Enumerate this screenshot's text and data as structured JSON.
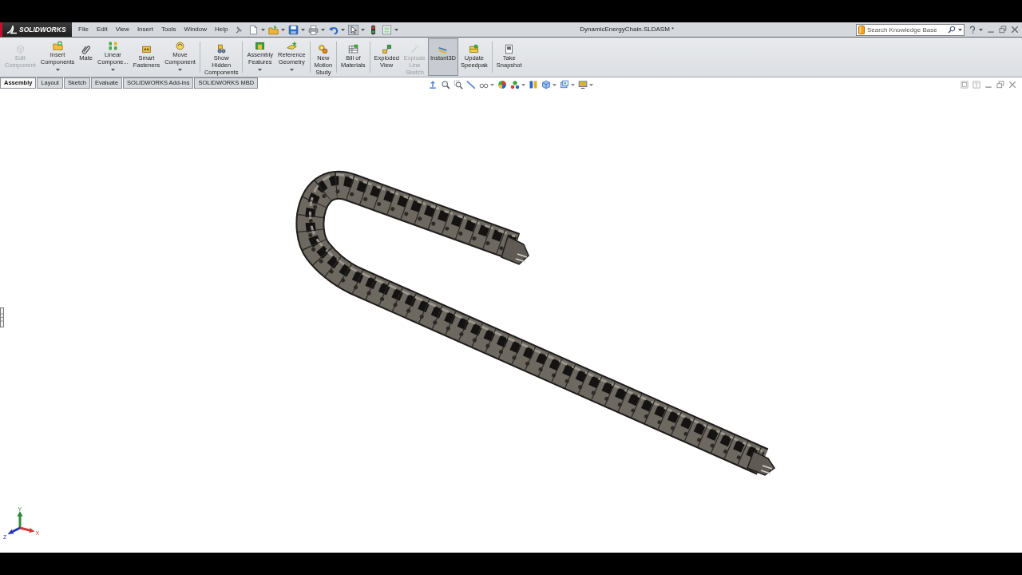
{
  "title_bar": {
    "brand": "SOLIDWORKS",
    "menu": [
      "File",
      "Edit",
      "View",
      "Insert",
      "Tools",
      "Window",
      "Help"
    ],
    "quick_access": [
      {
        "has_menu": true,
        "selected": false
      },
      {
        "has_menu": true,
        "selected": false
      },
      {
        "has_menu": true,
        "selected": false
      },
      {
        "has_menu": true,
        "selected": false
      },
      {
        "has_menu": true,
        "selected": false
      },
      {
        "has_menu": true,
        "selected": true
      },
      {
        "has_menu": false,
        "selected": false
      },
      {
        "has_menu": true,
        "selected": false
      }
    ],
    "document_title": "DynamicEnergyChain.SLDASM *",
    "search": {
      "placeholder": "Search Knowledge Base"
    }
  },
  "command_manager": {
    "groups": [
      [
        {
          "lines": [
            "Edit",
            "Component"
          ],
          "has_menu": false,
          "disabled": true,
          "selected": false
        },
        {
          "lines": [
            "Insert",
            "Components"
          ],
          "has_menu": true,
          "disabled": false,
          "selected": false
        },
        {
          "lines": [
            "Mate"
          ],
          "has_menu": false,
          "disabled": false,
          "selected": false
        },
        {
          "lines": [
            "Linear",
            "Compone..."
          ],
          "has_menu": true,
          "disabled": false,
          "selected": false
        },
        {
          "lines": [
            "Smart",
            "Fasteners"
          ],
          "has_menu": false,
          "disabled": false,
          "selected": false
        },
        {
          "lines": [
            "Move",
            "Component"
          ],
          "has_menu": true,
          "disabled": false,
          "selected": false
        }
      ],
      [
        {
          "lines": [
            "Show",
            "Hidden",
            "Components"
          ],
          "has_menu": false,
          "disabled": false,
          "selected": false
        }
      ],
      [
        {
          "lines": [
            "Assembly",
            "Features"
          ],
          "has_menu": true,
          "disabled": false,
          "selected": false
        },
        {
          "lines": [
            "Reference",
            "Geometry"
          ],
          "has_menu": true,
          "disabled": false,
          "selected": false
        }
      ],
      [
        {
          "lines": [
            "New",
            "Motion",
            "Study"
          ],
          "has_menu": false,
          "disabled": false,
          "selected": false
        }
      ],
      [
        {
          "lines": [
            "Bill of",
            "Materials"
          ],
          "has_menu": false,
          "disabled": false,
          "selected": false
        }
      ],
      [
        {
          "lines": [
            "Exploded",
            "View"
          ],
          "has_menu": false,
          "disabled": false,
          "selected": false
        },
        {
          "lines": [
            "Explode",
            "Line",
            "Sketch"
          ],
          "has_menu": false,
          "disabled": true,
          "selected": false
        },
        {
          "lines": [
            "Instant3D"
          ],
          "has_menu": false,
          "disabled": false,
          "selected": true
        },
        {
          "lines": [
            "Update",
            "Speedpak"
          ],
          "has_menu": false,
          "disabled": false,
          "selected": false
        }
      ],
      [
        {
          "lines": [
            "Take",
            "Snapshot"
          ],
          "has_menu": false,
          "disabled": false,
          "selected": false
        }
      ]
    ]
  },
  "tabs": [
    {
      "label": "Assembly",
      "selected": true
    },
    {
      "label": "Layout",
      "selected": false
    },
    {
      "label": "Sketch",
      "selected": false
    },
    {
      "label": "Evaluate",
      "selected": false
    },
    {
      "label": "SOLIDWORKS Add-Ins",
      "selected": false
    },
    {
      "label": "SOLIDWORKS MBD",
      "selected": false
    }
  ],
  "view_toolbar": [
    {
      "has_menu": false
    },
    {
      "has_menu": false
    },
    {
      "has_menu": false
    },
    {
      "has_menu": false
    },
    {
      "has_menu": true
    },
    {
      "has_menu": false
    },
    {
      "has_menu": true
    },
    {
      "has_menu": false
    },
    {
      "has_menu": true
    },
    {
      "has_menu": true
    },
    {
      "has_menu": true
    }
  ],
  "triad": {
    "axes": [
      {
        "label": "Y",
        "color": "#2e8b3a"
      },
      {
        "label": "Z",
        "color": "#2433b0"
      },
      {
        "label": "X",
        "color": "#d03a3a"
      }
    ]
  }
}
